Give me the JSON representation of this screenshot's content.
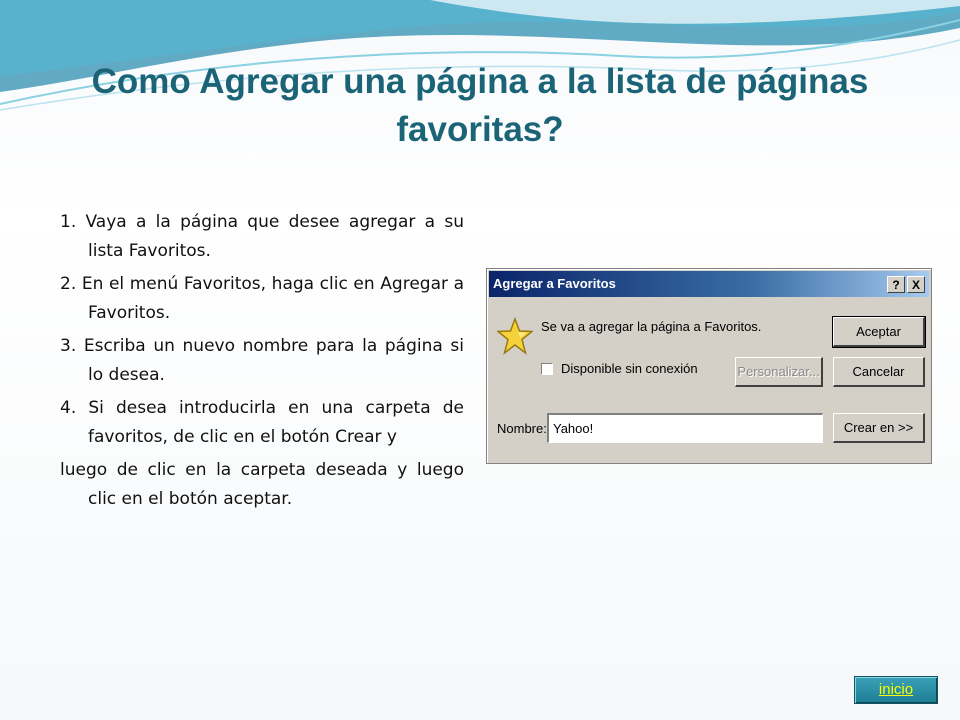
{
  "slide": {
    "title": "Como Agregar una página a la lista de páginas favoritas?",
    "steps": [
      "1. Vaya a la página que desee agregar a su lista Favoritos.",
      "2. En el menú Favoritos, haga clic en Agregar a Favoritos.",
      "3. Escriba un nuevo nombre para la página si lo desea.",
      "4. Si desea introducirla en una carpeta de favoritos, de clic en el botón Crear y",
      "luego de clic en la carpeta deseada y luego clic en el botón aceptar."
    ],
    "nav_link": "inicio"
  },
  "dialog": {
    "title": "Agregar a Favoritos",
    "help_button": "?",
    "close_button": "X",
    "message": "Se va a agregar la página a Favoritos.",
    "offline_checkbox_label": "Disponible sin conexión",
    "offline_checked": false,
    "personalize_button": "Personalizar...",
    "accept_button": "Aceptar",
    "cancel_button": "Cancelar",
    "create_button": "Crear en >>",
    "name_label": "Nombre:",
    "name_value": "Yahoo!"
  },
  "colors": {
    "title": "#1b6478",
    "dialog_face": "#d4d0c8",
    "titlebar_start": "#0a246a",
    "nav_button": "#1e7e94",
    "nav_text": "#ffff00"
  },
  "icons": {
    "dialog": "star-icon"
  }
}
